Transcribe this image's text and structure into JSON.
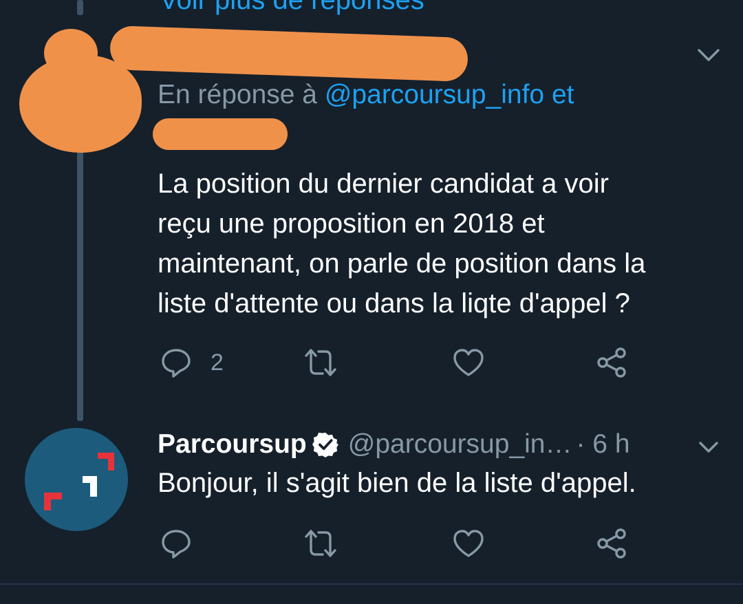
{
  "thread": {
    "more_replies_label": "Voir plus de réponses"
  },
  "tweet1": {
    "reply_prefix": "En réponse à ",
    "reply_mention": "@parcoursup_info",
    "reply_conjunction": " et",
    "text_lines": [
      "La position du dernier candidat a voir",
      "reçu une proposition en 2018 et",
      "maintenant, on parle de position dans la",
      "liste d'attente ou dans la liqte d'appel ?"
    ],
    "reply_count": "2"
  },
  "tweet2": {
    "name": "Parcoursup",
    "handle": "@parcoursup_in…",
    "time": "· 6 h",
    "text": "Bonjour, il s'agit bien de la liste d'appel."
  },
  "icons": {
    "reply": "reply-icon",
    "retweet": "retweet-icon",
    "like": "like-icon",
    "share": "share-icon",
    "chevron": "chevron-down-icon",
    "verified": "verified-badge-icon"
  },
  "colors": {
    "background": "#15202b",
    "accent": "#1da1f2",
    "muted": "#8899a6",
    "redaction": "#f0914a",
    "avatar_bg": "#1c5b7c",
    "logo_red": "#e6333a"
  }
}
